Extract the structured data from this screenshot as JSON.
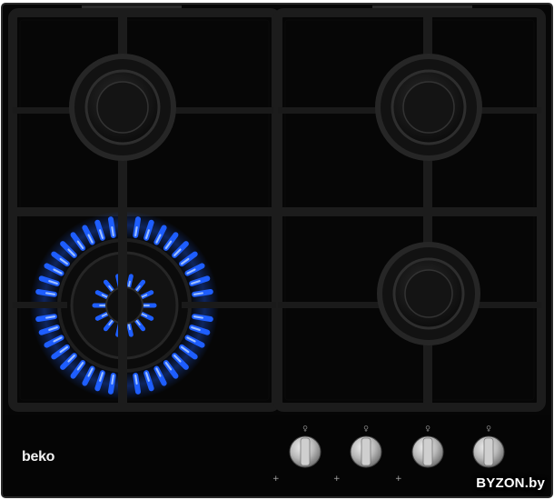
{
  "brand": "beko",
  "watermark": "BYZON.by",
  "burners": [
    {
      "position": "rear-left",
      "lit": false
    },
    {
      "position": "rear-right",
      "lit": false
    },
    {
      "position": "front-left",
      "lit": true
    },
    {
      "position": "front-right",
      "lit": false
    }
  ],
  "knobs": [
    {
      "name": "knob-1"
    },
    {
      "name": "knob-2"
    },
    {
      "name": "knob-3"
    },
    {
      "name": "knob-4"
    }
  ],
  "colors": {
    "glass": "#050505",
    "grate": "#1b1b1b",
    "flame": "#1e5eff",
    "knob": "#b8b8b8"
  }
}
